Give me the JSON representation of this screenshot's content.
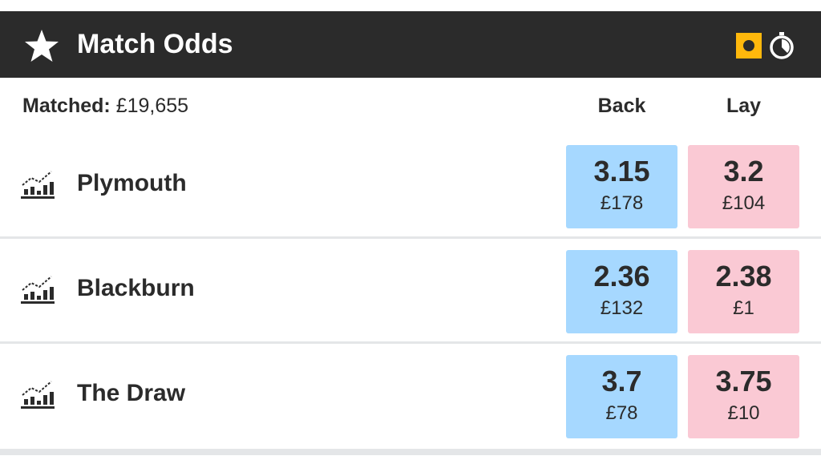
{
  "market": {
    "title": "Match Odds",
    "matched_label": "Matched:",
    "matched_value": "£19,655"
  },
  "columns": {
    "back": "Back",
    "lay": "Lay"
  },
  "runners": [
    {
      "name": "Plymouth",
      "back": {
        "odds": "3.15",
        "stake": "£178"
      },
      "lay": {
        "odds": "3.2",
        "stake": "£104"
      }
    },
    {
      "name": "Blackburn",
      "back": {
        "odds": "2.36",
        "stake": "£132"
      },
      "lay": {
        "odds": "2.38",
        "stake": "£1"
      }
    },
    {
      "name": "The Draw",
      "back": {
        "odds": "3.7",
        "stake": "£78"
      },
      "lay": {
        "odds": "3.75",
        "stake": "£10"
      }
    }
  ],
  "colors": {
    "header_bg": "#2b2b2b",
    "back_bg": "#a6d8ff",
    "lay_bg": "#fac9d4",
    "live_accent": "#ffb80c"
  },
  "icons": {
    "favourite": "star-icon",
    "live": "in-play-icon",
    "timer": "timer-icon",
    "runner": "chart-icon"
  }
}
